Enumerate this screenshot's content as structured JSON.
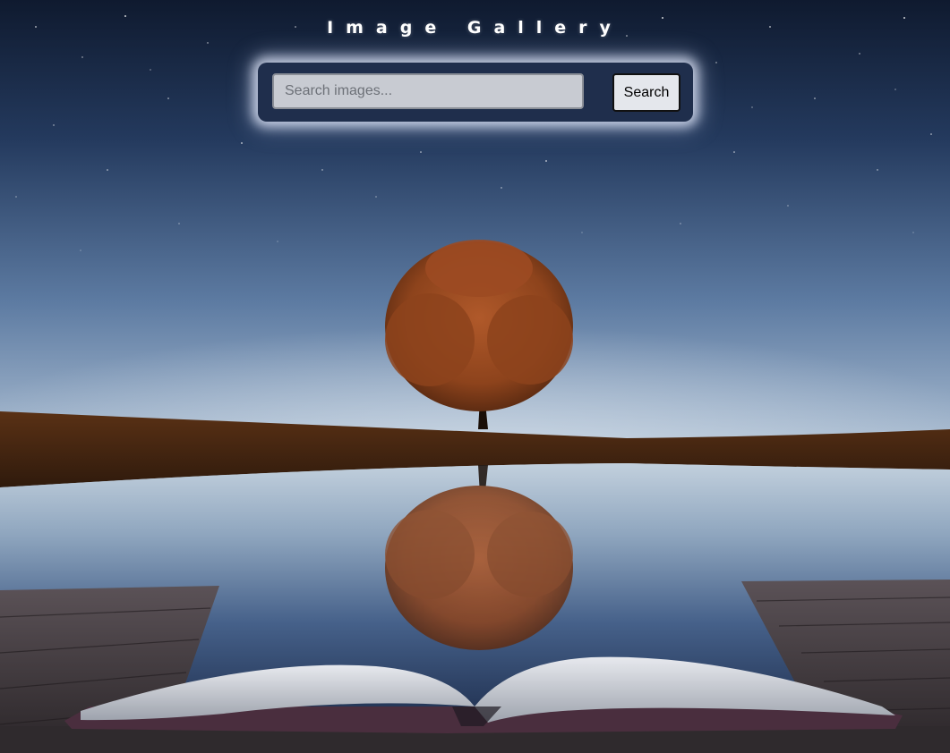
{
  "header": {
    "title": "Image Gallery"
  },
  "search": {
    "placeholder": "Search images...",
    "value": "",
    "button_label": "Search",
    "icon": "magnifier-icon"
  },
  "background": {
    "icon": "gallery-background-image"
  },
  "colors": {
    "sky_top": "#121b30",
    "sky_horizon": "#a6b9cf",
    "search_panel": "#1f2e4c",
    "search_glow": "#e6ecff",
    "tree_foliage": "#9c4a22"
  }
}
